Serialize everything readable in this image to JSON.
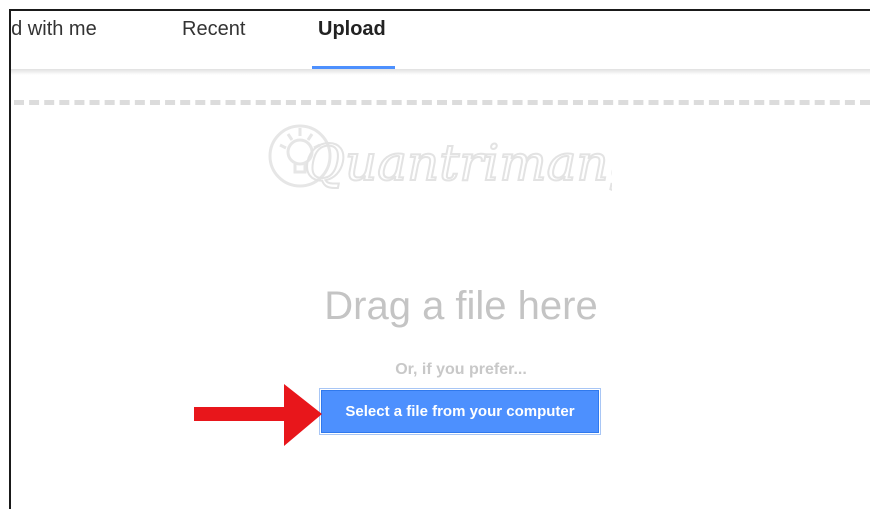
{
  "tabs": {
    "shared": "ed with me",
    "recent": "Recent",
    "upload": "Upload"
  },
  "watermark": {
    "text": "Quantrimang"
  },
  "dropzone": {
    "drag_text": "Drag a file here",
    "prefer_text": "Or, if you prefer...",
    "select_button": "Select a file from your computer"
  },
  "colors": {
    "accent": "#4d90fe",
    "arrow": "#e8161b",
    "muted_text": "#c4c4c4"
  },
  "icons": {
    "watermark_logo": "lightbulb-icon",
    "annotation": "red-arrow-icon"
  }
}
